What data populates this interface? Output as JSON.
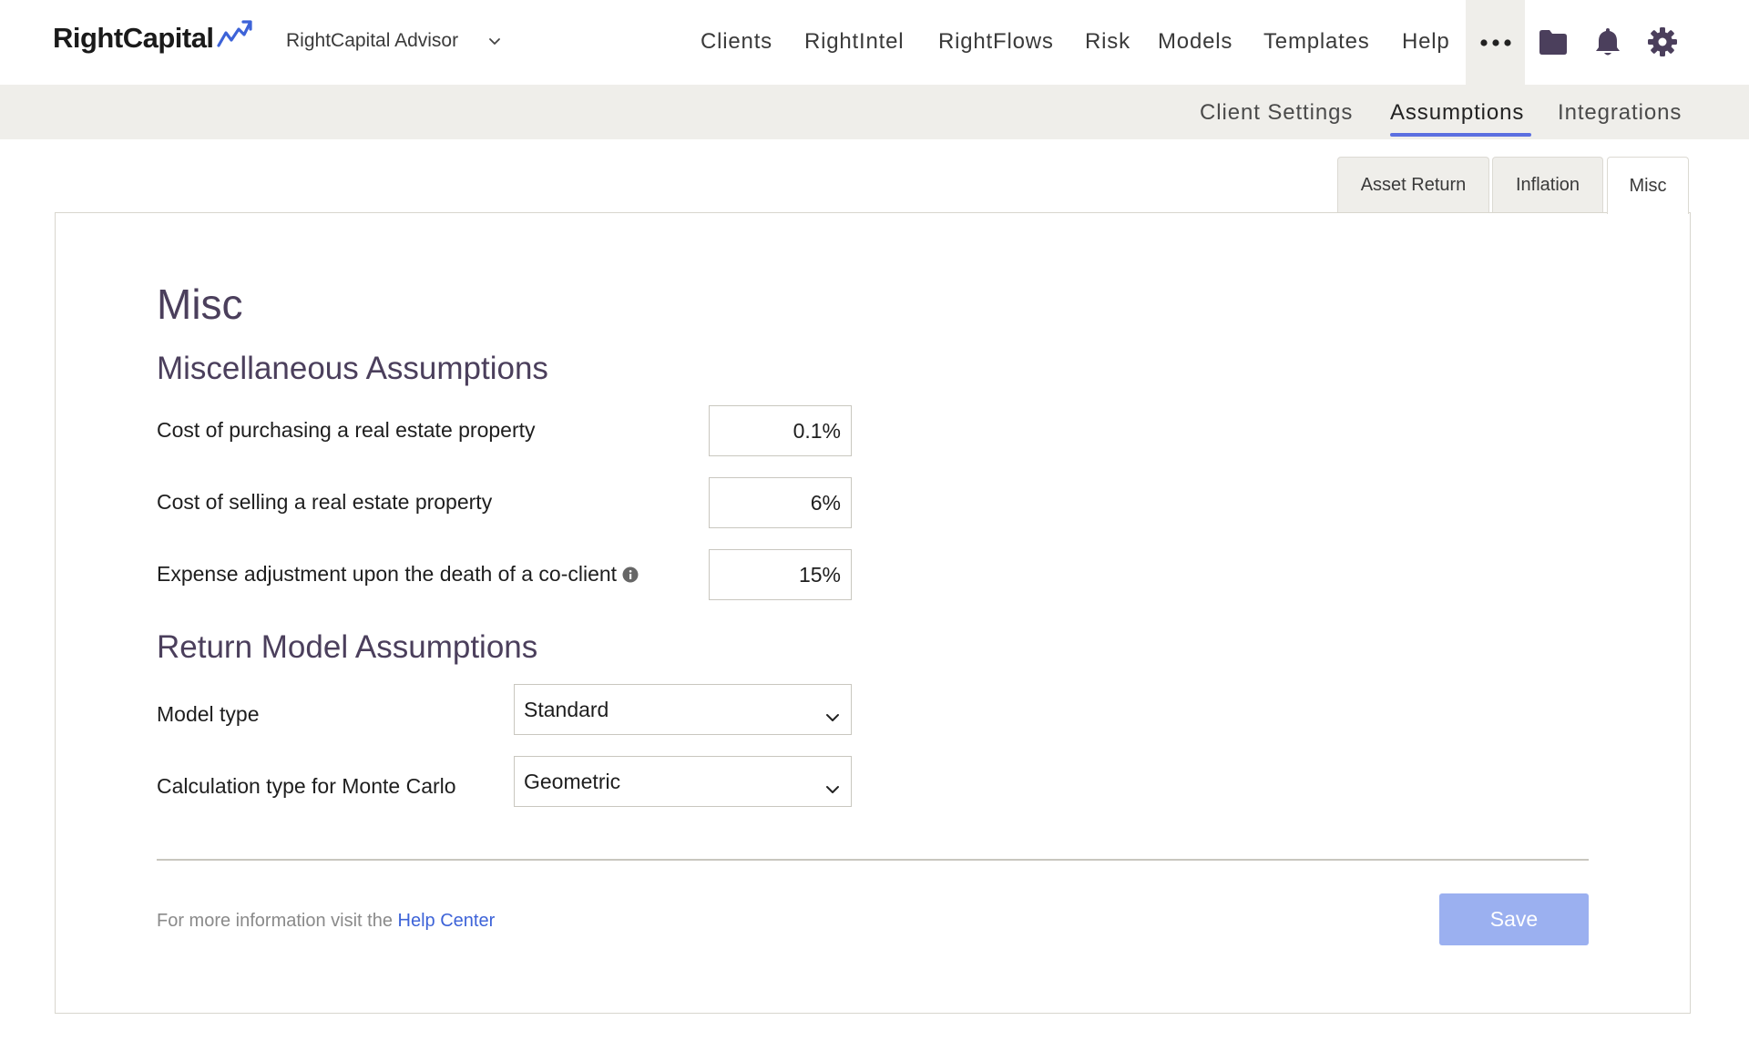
{
  "brand": {
    "name": "RightCapital",
    "accent": "#3d63d8"
  },
  "header": {
    "firm_selector": "RightCapital Advisor",
    "nav": [
      "Clients",
      "RightIntel",
      "RightFlows",
      "Risk",
      "Models",
      "Templates",
      "Help"
    ],
    "icons": [
      "more-icon",
      "folder-icon",
      "bell-icon",
      "gear-icon"
    ]
  },
  "subnav": {
    "tabs": [
      "Client Settings",
      "Assumptions",
      "Integrations"
    ],
    "active": "Assumptions"
  },
  "card_tabs": {
    "tabs": [
      "Asset Return",
      "Inflation",
      "Misc"
    ],
    "active": "Misc"
  },
  "page": {
    "title": "Misc",
    "misc_section": {
      "heading": "Miscellaneous Assumptions",
      "fields": [
        {
          "label": "Cost of purchasing a real estate property",
          "value": "0.1%"
        },
        {
          "label": "Cost of selling a real estate property",
          "value": "6%"
        },
        {
          "label": "Expense adjustment upon the death of a co-client",
          "value": "15%",
          "has_info": true
        }
      ]
    },
    "return_section": {
      "heading": "Return Model Assumptions",
      "fields": [
        {
          "label": "Model type",
          "value": "Standard"
        },
        {
          "label": "Calculation type for Monte Carlo",
          "value": "Geometric"
        }
      ]
    },
    "footer": {
      "text": "For more information visit the ",
      "link": "Help Center",
      "save": "Save"
    }
  }
}
